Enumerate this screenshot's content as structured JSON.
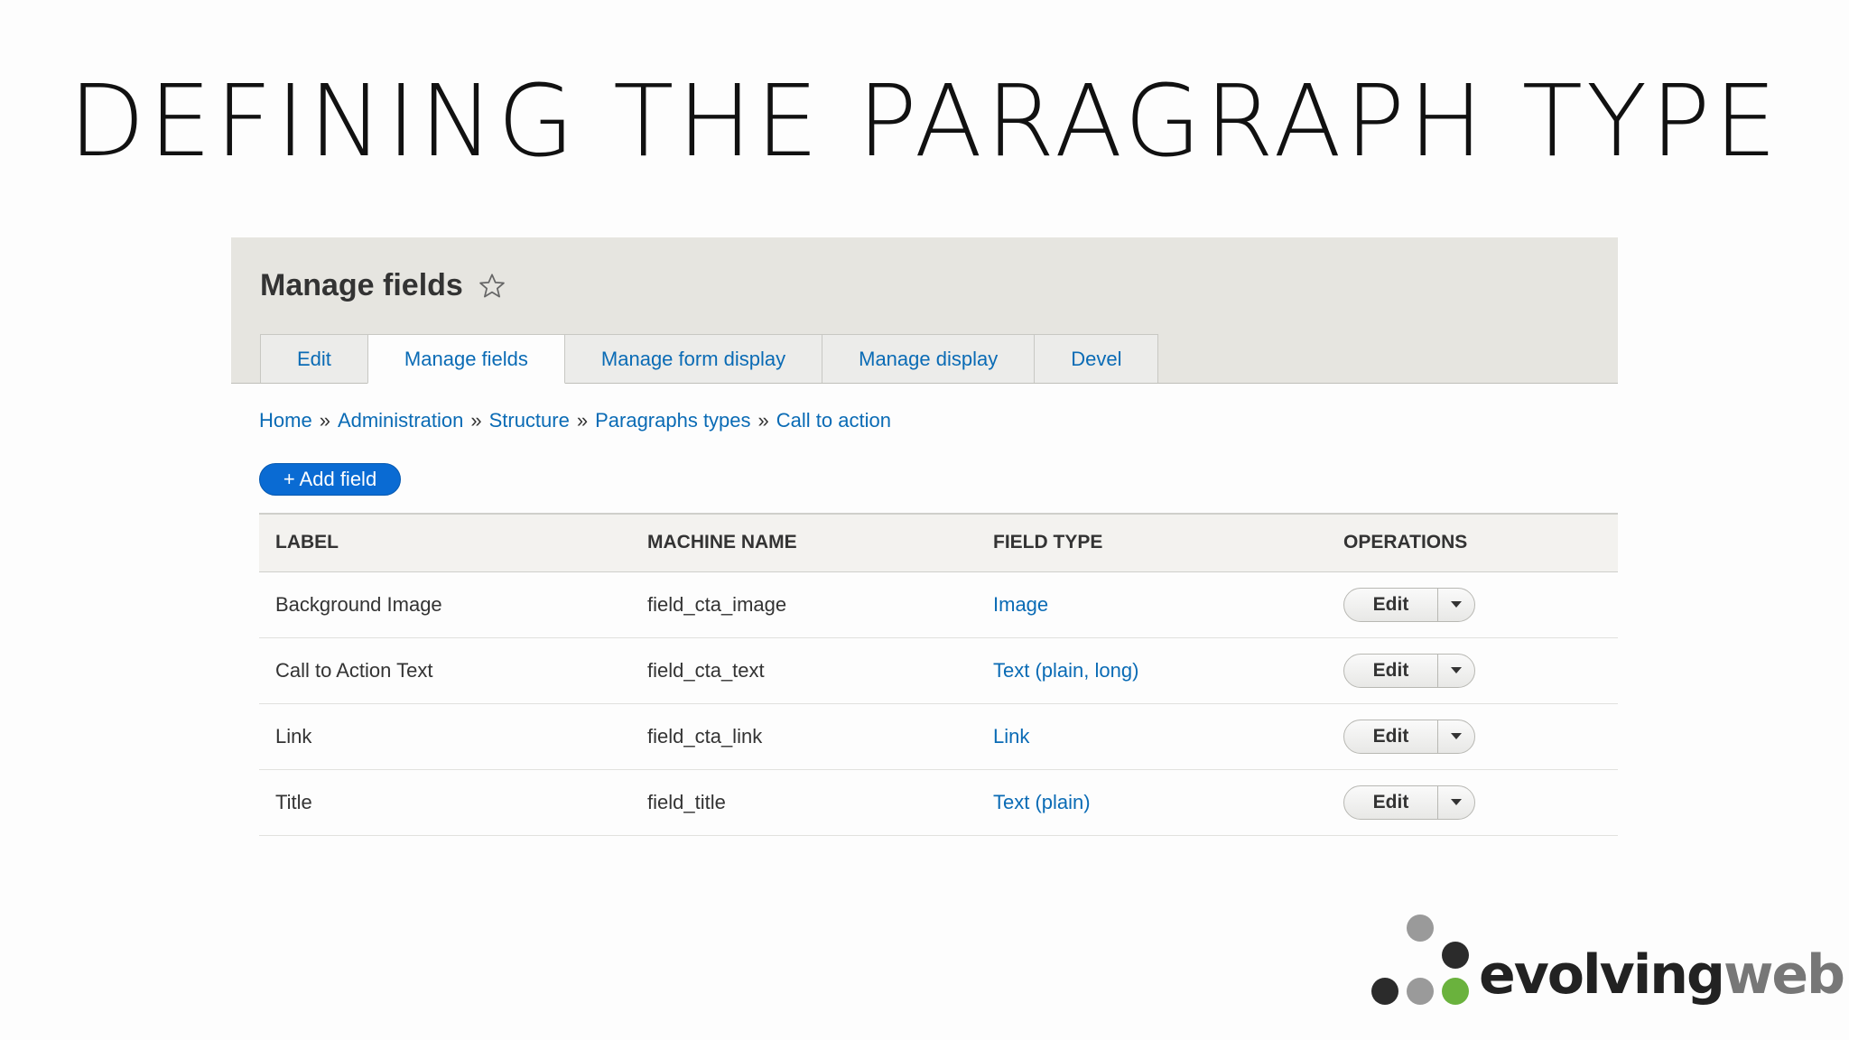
{
  "slide": {
    "title": "DEFINING THE PARAGRAPH TYPE"
  },
  "page": {
    "title": "Manage fields"
  },
  "tabs": [
    "Edit",
    "Manage fields",
    "Manage form display",
    "Manage display",
    "Devel"
  ],
  "active_tab": "Manage fields",
  "breadcrumb": [
    "Home",
    "Administration",
    "Structure",
    "Paragraphs types",
    "Call to action"
  ],
  "breadcrumb_separator": "»",
  "add_field_label": "+ Add field",
  "table": {
    "headers": [
      "LABEL",
      "MACHINE NAME",
      "FIELD TYPE",
      "OPERATIONS"
    ],
    "rows": [
      {
        "label": "Background Image",
        "machine_name": "field_cta_image",
        "field_type": "Image",
        "operation": "Edit"
      },
      {
        "label": "Call to Action Text",
        "machine_name": "field_cta_text",
        "field_type": "Text (plain, long)",
        "operation": "Edit"
      },
      {
        "label": "Link",
        "machine_name": "field_cta_link",
        "field_type": "Link",
        "operation": "Edit"
      },
      {
        "label": "Title",
        "machine_name": "field_title",
        "field_type": "Text (plain)",
        "operation": "Edit"
      }
    ]
  },
  "logo": {
    "part1": "evolving",
    "part2": "web"
  },
  "icons": {
    "favorite": "star-outline-icon",
    "dropdown": "caret-down-icon"
  },
  "colors": {
    "link": "#0a6bb5",
    "primary_button": "#0a6bd3",
    "header_bg": "#e6e5e0",
    "logo_green": "#6ab23d",
    "logo_dark": "#222222",
    "logo_gray": "#9a9a9a"
  }
}
